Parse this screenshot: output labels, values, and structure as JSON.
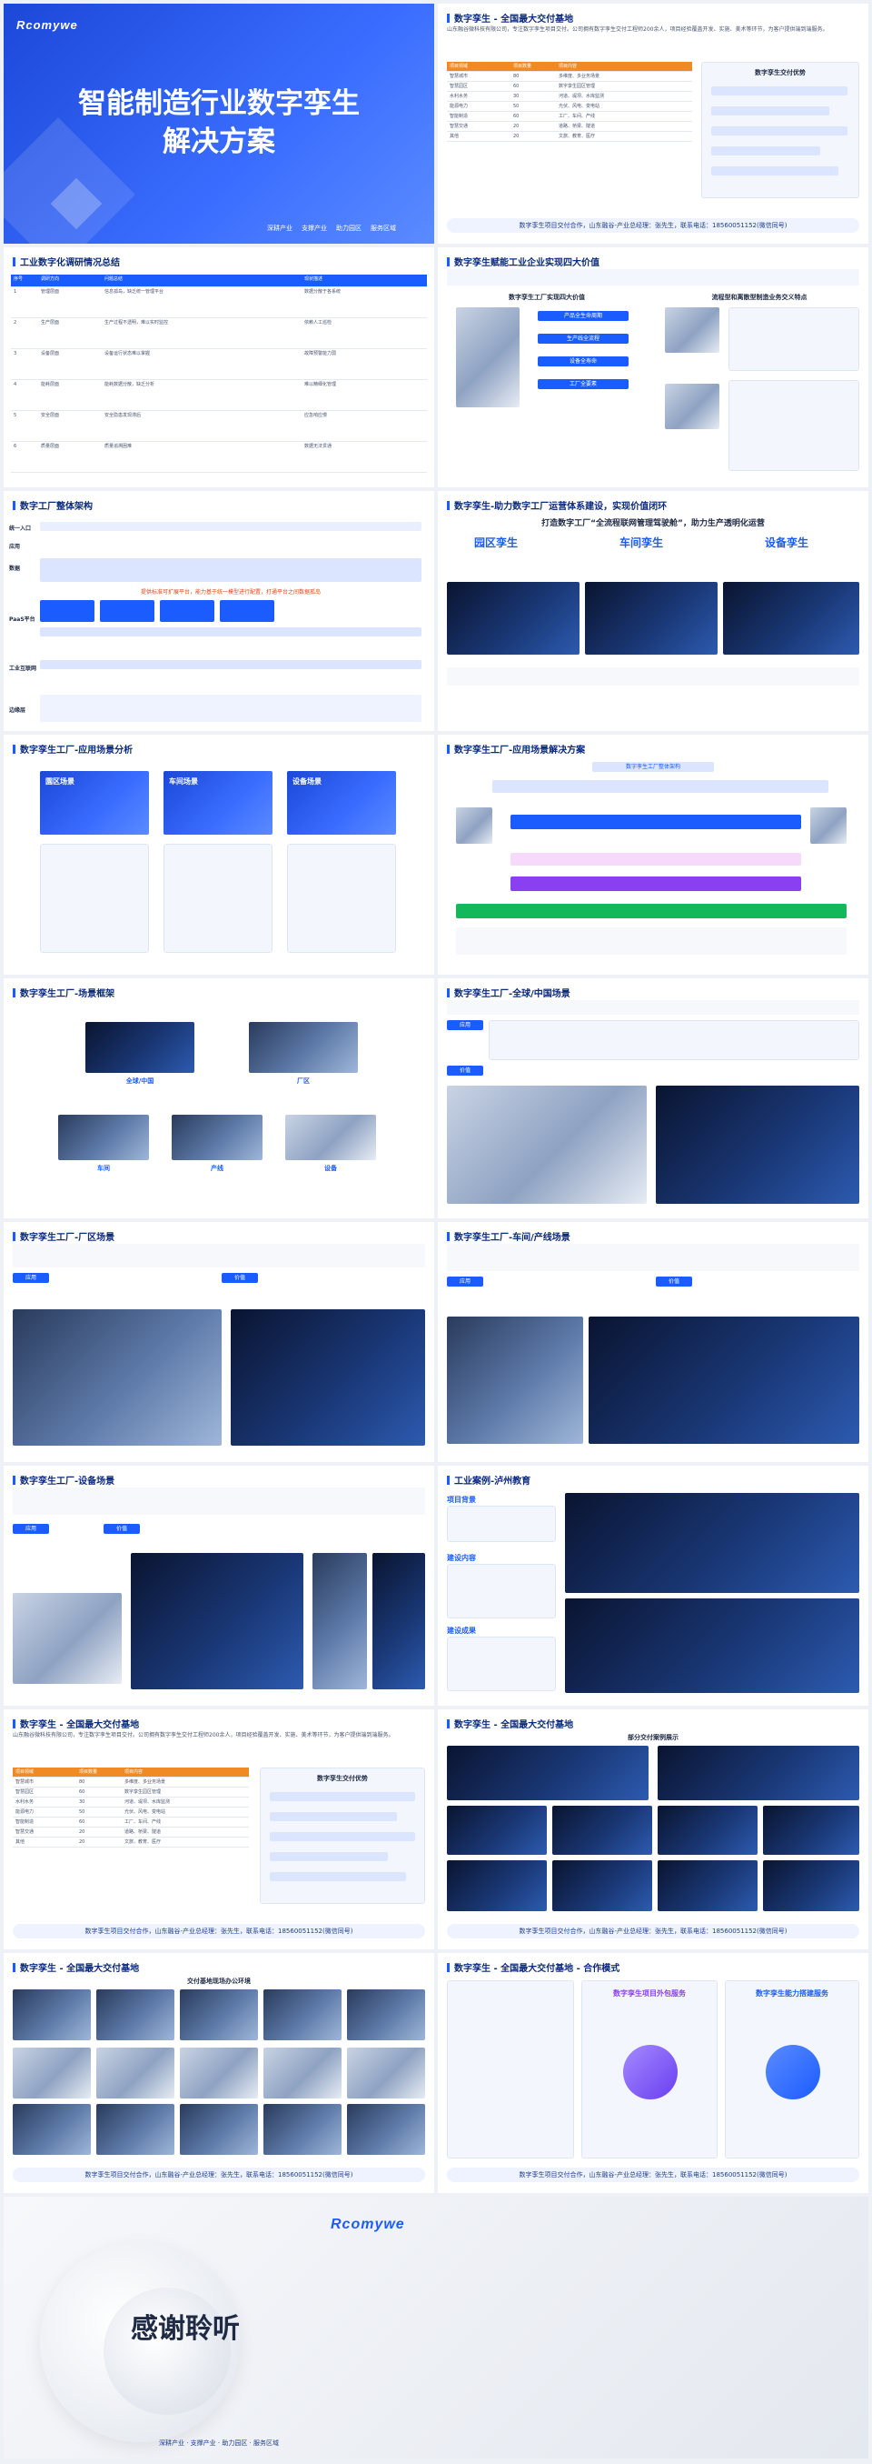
{
  "cover": {
    "logo": "Rcomywe",
    "title_line1": "智能制造行业数字孪生",
    "title_line2": "解决方案",
    "tags": [
      "深耕产业",
      "支撑产业",
      "助力园区",
      "服务区域"
    ]
  },
  "s2": {
    "header": "数字孪生 - 全国最大交付基地",
    "intro": "山东融谷微科技有限公司，专注数字孪生项目交付。公司拥有数字孪生交付工程师200余人，项目经验覆盖开发、实施、美术等环节，为客户提供端到端服务。",
    "table_header": [
      "项目领域",
      "项目数量",
      "项目内容"
    ],
    "rows": [
      [
        "智慧城市",
        "80",
        "多维度、多业务场景"
      ],
      [
        "智慧园区",
        "60",
        "数字孪生园区管理"
      ],
      [
        "水利水务",
        "30",
        "河道、堤坝、水库监测"
      ],
      [
        "能源电力",
        "50",
        "光伏、风电、变电站"
      ],
      [
        "智能制造",
        "60",
        "工厂、车间、产线"
      ],
      [
        "智慧交通",
        "20",
        "道路、桥梁、隧道"
      ],
      [
        "其他",
        "20",
        "文旅、教育、医疗"
      ]
    ],
    "right_title": "数字孪生交付优势",
    "footer": "数字孪生项目交付合作，山东融谷-产业总经理：张先生，联系电话：18560051152(微信同号)"
  },
  "s3": {
    "header": "工业数字化调研情况总结",
    "table_header": [
      "序号",
      "调研方向",
      "问题总结",
      "现状描述"
    ],
    "rows": [
      [
        "1",
        "管理层面",
        "信息孤岛，缺乏统一管理平台",
        "数据分散于各系统"
      ],
      [
        "2",
        "生产层面",
        "生产过程不透明，难以实时监控",
        "依赖人工巡检"
      ],
      [
        "3",
        "设备层面",
        "设备运行状态难以掌握",
        "故障预警能力弱"
      ],
      [
        "4",
        "能耗层面",
        "能耗数据分散，缺乏分析",
        "难以精细化管理"
      ],
      [
        "5",
        "安全层面",
        "安全隐患发现滞后",
        "应急响应慢"
      ],
      [
        "6",
        "质量层面",
        "质量追溯困难",
        "数据无法贯通"
      ]
    ]
  },
  "s4": {
    "header": "数字孪生赋能工业企业实现四大价值",
    "left_title": "数字孪生工厂实现四大价值",
    "right_title": "流程型和离散型制造业务交义特点",
    "values": [
      "产品全生命周期",
      "生产线全流程",
      "设备全寿命",
      "工厂全要素"
    ]
  },
  "s5": {
    "header": "数字工厂整体架构",
    "rows": [
      "统一入口",
      "应用",
      "数据",
      "PaaS平台",
      "工业互联网",
      "边缘层"
    ],
    "band": "提供标准可扩展平台，能力基于统一模型进行配置，打通平台之间数据孤岛"
  },
  "s6": {
    "header": "数字孪生-助力数字工厂运营体系建设，实现价值闭环",
    "slogan": "打造数字工厂“全流程联网管理驾驶舱”，助力生产透明化运营",
    "cols": [
      "园区孪生",
      "车间孪生",
      "设备孪生"
    ]
  },
  "s7": {
    "header": "数字孪生工厂-应用场景分析",
    "cards": [
      "園区场景",
      "车间场景",
      "设备场景"
    ]
  },
  "s8": {
    "header": "数字孪生工厂-应用场景解决方案",
    "title": "数字孪生工厂整体架构"
  },
  "s9": {
    "header": "数字孪生工厂-场景框架",
    "labels": [
      "全球/中国",
      "厂区",
      "车间",
      "产线",
      "设备"
    ]
  },
  "s10": {
    "header": "数字孪生工厂-全球/中国场景",
    "tag1": "应用",
    "tag2": "价值"
  },
  "s11": {
    "header": "数字孪生工厂-厂区场景",
    "tag1": "应用",
    "tag2": "价值"
  },
  "s12": {
    "header": "数字孪生工厂-车间/产线场景",
    "tag1": "应用",
    "tag2": "价值"
  },
  "s13": {
    "header": "数字孪生工厂-设备场景",
    "tag1": "应用",
    "tag2": "价值"
  },
  "s14": {
    "header": "工业案例-泸州教育",
    "sections": [
      "项目背景",
      "建设内容",
      "建设成果"
    ]
  },
  "s15": {
    "header": "数字孪生 - 全国最大交付基地",
    "right_title": "数字孪生交付优势",
    "footer": "数字孪生项目交付合作，山东融谷-产业总经理：张先生，联系电话：18560051152(微信同号)"
  },
  "s16": {
    "header": "数字孪生 - 全国最大交付基地",
    "title": "部分交付案例展示",
    "footer": "数字孪生项目交付合作，山东融谷-产业总经理：张先生，联系电话：18560051152(微信同号)"
  },
  "s17": {
    "header": "数字孪生 - 全国最大交付基地",
    "title": "交付基地现场办公环境",
    "footer": "数字孪生项目交付合作，山东融谷-产业总经理：张先生，联系电话：18560051152(微信同号)"
  },
  "s18": {
    "header": "数字孪生 - 全国最大交付基地 - 合作模式",
    "mid_title": "数字孪生项目外包服务",
    "right_title": "数字孪生能力搭建服务",
    "footer": "数字孪生项目交付合作，山东融谷-产业总经理：张先生，联系电话：18560051152(微信同号)"
  },
  "end": {
    "logo": "Rcomywe",
    "thanks": "感谢聆听",
    "tagline": "深耕产业 · 支撑产业 · 助力园区 · 服务区域"
  },
  "colors": {
    "primary": "#1a5cff",
    "navy": "#0b2a7a",
    "orange": "#f08a24"
  }
}
